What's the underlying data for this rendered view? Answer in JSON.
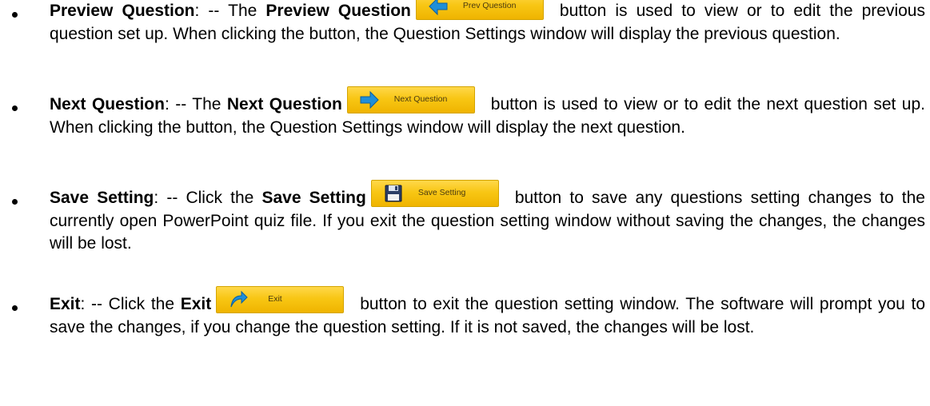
{
  "items": [
    {
      "term": "Preview Question",
      "intro": ": -- The ",
      "term_inline": "Preview Question",
      "button_label": "Prev Question",
      "rest": "button is used to view or to edit the previous question set up. When clicking the button, the Question Settings window will display the previous question."
    },
    {
      "term": "Next Question",
      "intro": ": -- The ",
      "term_inline": "Next Question",
      "button_label": "Next Question",
      "rest": "button is used to view or to edit the next question set up. When clicking the button, the Question Settings window will display the next question."
    },
    {
      "term": "Save Setting",
      "intro": ": -- Click the ",
      "term_inline": "Save Setting",
      "button_label": "Save Setting",
      "rest": "button to save any questions setting changes to the currently open PowerPoint quiz file. If you exit the question setting window without saving the changes, the changes will be lost."
    },
    {
      "term": "Exit",
      "intro": ": -- Click the ",
      "term_inline": "Exit",
      "button_label": "Exit",
      "rest": "button to exit the question setting window. The software will prompt you to save the changes, if you change the question setting. If it is not saved, the changes will be lost."
    }
  ],
  "icons": {
    "prev": "arrow-left-icon",
    "next": "arrow-right-icon",
    "save": "floppy-disk-icon",
    "exit": "curved-arrow-icon"
  },
  "colors": {
    "button_fill": "#f8c614",
    "button_border": "#d4a400",
    "arrow_blue": "#1f8fd8"
  }
}
